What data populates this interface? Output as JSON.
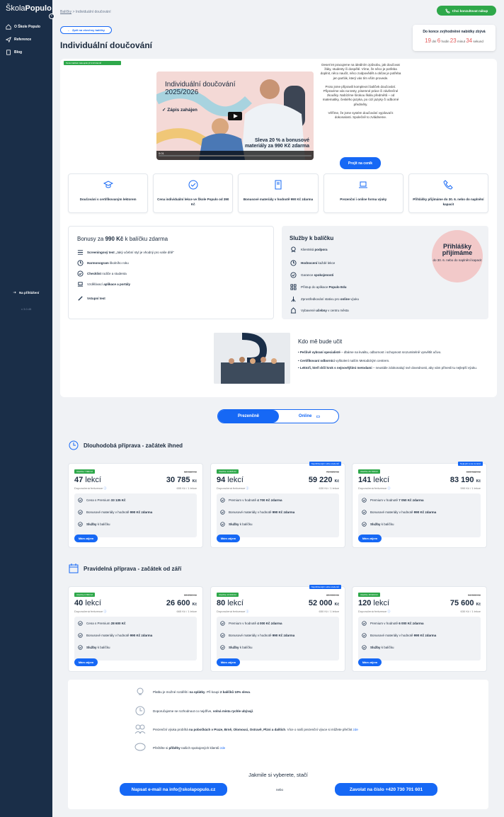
{
  "sidebar": {
    "logo_light": "Škola",
    "logo_bold": "Populo",
    "items": [
      {
        "label": "O Škole Populo",
        "icon": "home-icon"
      },
      {
        "label": "Reference",
        "icon": "paper-plane-icon"
      },
      {
        "label": "Blog",
        "icon": "document-icon"
      }
    ],
    "signin": "Na přihlášení",
    "version": "v 3.0.45"
  },
  "breadcrumb": {
    "parent": "Balíčky",
    "sep": ">",
    "current": "Individuální doučování"
  },
  "header": {
    "consult_button": "Chci konzultovat nákup",
    "back_button": "Zpět na všechny balíčky",
    "title": "Individuální doučování"
  },
  "countdown": {
    "title": "Do konce zvýhodněné nabídky zbývá",
    "days": "19",
    "days_label": "dní",
    "hours": "6",
    "hours_label": "hodin",
    "minutes": "23",
    "minutes_label": "minut",
    "seconds": "34",
    "seconds_label": "sekund"
  },
  "top_badge": "Tento balíček zakoupilo již 213 klientů",
  "video": {
    "title_1": "Individuální doučování",
    "title_2": "2025/2026",
    "open": "Zápis zahájen",
    "sale_1": "Sleva 20 % a bonusové",
    "sale_2": "materiály za 990 Kč zdarma",
    "time": "0:01"
  },
  "intro": {
    "p1": "Deset let pracujeme na ideálním způsobu, jak doučovat žáky, studenty či dospělé. Víme, že něco je potřeba doplnit, něco naučit, něco zodpovědět a občas je potřeba jen parťák, který vás tím vším provede.",
    "p2": "Proto jsme připravili komplexní balíček doučování. Připravíme vás na testy, písemné práce či závěrečné zkoušky. Nabízíme širokou škálu předmětů – od matematiky, českého jazyka, po cizí jazyky či odborné předměty.",
    "p3": "Věříme, že jsme systém doučování vypiloval k dokonalosti. Společně to zvládneme.",
    "button": "Projít na ceník"
  },
  "features": [
    {
      "label": "Doučování s certifikovaným lektorem",
      "icon": "graduation-cap-icon"
    },
    {
      "label": "Cena individuální lekce ve Škole Populo od 390 Kč",
      "icon": "check-circle-icon"
    },
    {
      "label": "Bonusové materiály v hodnotě 990 Kč zdarma",
      "icon": "book-icon"
    },
    {
      "label": "Prezenční i online forma výuky",
      "icon": "laptop-icon"
    },
    {
      "label": "Přihlášky přijímáme do 30. 6. nebo do naplnění kapacit",
      "icon": "phone-icon"
    }
  ],
  "bonus": {
    "title_a": "Bonusy za ",
    "title_b": "990 Kč",
    "title_c": " k balíčku zdarma",
    "items": [
      {
        "bold": "Screeningový test",
        "text": " „Jaký učební styl je vhodný pro vaše dítě\"",
        "icon": "checklist-icon"
      },
      {
        "bold": "Harmonogram",
        "text": " školního roku",
        "icon": "clock-icon"
      },
      {
        "bold": "Checklist",
        "text": " rodiče a studenta",
        "icon": "check-circle-icon"
      },
      {
        "bold": "",
        "text": "Vzdělávací ",
        "bold2": "aplikace a portály",
        "icon": "laptop-icon"
      },
      {
        "bold": "Vstupní test",
        "text": "",
        "icon": "pen-icon"
      }
    ]
  },
  "services": {
    "title": "Služby k balíčku",
    "items": [
      {
        "text": "Klientská ",
        "bold": "podpora",
        "icon": "support-icon"
      },
      {
        "bold": "Hodnocení",
        "text": " každé lekce",
        "icon": "clock-icon"
      },
      {
        "text": "Garance ",
        "bold": "spokojenosti",
        "icon": "check-circle-icon"
      },
      {
        "text": "Přístup do aplikace ",
        "bold": "Populo Edu",
        "icon": "grid-icon"
      },
      {
        "text": "Zprostředkování stativu pro ",
        "bold": "online",
        "text2": " výuku",
        "icon": "tripod-icon"
      },
      {
        "text": "Vybavené ",
        "bold": "učebny",
        "text2": " v centru města",
        "icon": "building-icon"
      }
    ],
    "bubble_title": "Přihlášky přijímáme",
    "bubble_text": "do 30. 6. nebo do naplnění kapacit"
  },
  "who": {
    "title": "Kdo mě bude učit",
    "items": [
      {
        "bold": "Pečlivě vybraní specialisté",
        "text": " – dbáme na kvalitu, odbornost i schopnost srozumitelně vysvětlit učivo."
      },
      {
        "bold": "Certifikovaní odborníci",
        "text": " vyškolení naším Metodickým centrem."
      },
      {
        "bold": "Lektoři, kteří drží krok s nejnovějšími metodami",
        "text": " – neustále zdokonalují své dovednosti, aby vám přinesli tu nejlepší výuku."
      }
    ]
  },
  "toggle": {
    "active": "Prezenčně",
    "inactive": "Online"
  },
  "sections": [
    {
      "title": "Dlouhodobá příprava - začátek ihned",
      "icon": "clock-arrow-icon",
      "cards": [
        {
          "badge": "Ušetříte 7 696 Kč",
          "rec": "",
          "old": "38 480 Kč",
          "lessons": "47",
          "lessons_word": "lekcí",
          "price": "30 785",
          "cur": "Kč",
          "freq": "Doporučená frekvence",
          "per": "655 Kč / 1 lekce",
          "items": [
            [
              "Cena s Premium ",
              "33 135 Kč",
              ""
            ],
            [
              "Bonusové materiály v hodnotě ",
              "990 Kč zdarma",
              ""
            ],
            [
              "",
              "Služby",
              " k balíčku"
            ]
          ],
          "button": "Mám zájem"
        },
        {
          "badge": "Ušetříte 14 805 Kč",
          "rec": "Nejoblíbenější volba studentů",
          "old": "74 025 Kč",
          "lessons": "94",
          "lessons_word": "lekcí",
          "price": "59 220",
          "cur": "Kč",
          "freq": "Doporučená frekvence",
          "per": "630 Kč / 1 lekce",
          "items": [
            [
              "Premium v hodnotě ",
              "4 700 Kč zdarma",
              ""
            ],
            [
              "Bonusové materiály v hodnotě ",
              "990 Kč zdarma",
              ""
            ],
            [
              "",
              "Služby",
              " k balíčku"
            ]
          ],
          "button": "Mám zájem"
        },
        {
          "badge": "Ušetříte 20 798 Kč",
          "rec": "Nejlepší cena za lekci",
          "old": "103 988 Kč",
          "lessons": "141",
          "lessons_word": "lekcí",
          "price": "83 190",
          "cur": "Kč",
          "freq": "Doporučená frekvence",
          "per": "590 Kč / 1 lekce",
          "items": [
            [
              "Premium v hodnotě ",
              "7 050 Kč zdarma",
              ""
            ],
            [
              "Bonusové materiály v hodnotě ",
              "990 Kč zdarma",
              ""
            ],
            [
              "",
              "Služby",
              " k balíčku"
            ]
          ],
          "button": "Mám zájem"
        }
      ]
    },
    {
      "title": "Pravidelná příprava - začátek od září",
      "icon": "calendar-icon",
      "cards": [
        {
          "badge": "Ušetříte 6 650 Kč",
          "rec": "",
          "old": "33 250 Kč",
          "lessons": "40",
          "lessons_word": "lekcí",
          "price": "26 600",
          "cur": "Kč",
          "freq": "Doporučená frekvence",
          "per": "665 Kč / 1 lekce",
          "items": [
            [
              "Cena s Premium ",
              "28 600 Kč",
              ""
            ],
            [
              "Bonusové materiály v hodnotě ",
              "990 Kč zdarma",
              ""
            ],
            [
              "",
              "Služby",
              " k balíčku"
            ]
          ],
          "button": "Mám zájem"
        },
        {
          "badge": "Ušetříte 13 000 Kč",
          "rec": "Nejoblíbenější volba studentů",
          "old": "65 000 Kč",
          "lessons": "80",
          "lessons_word": "lekcí",
          "price": "52 000",
          "cur": "Kč",
          "freq": "Doporučená frekvence",
          "per": "650 Kč / 1 lekce",
          "items": [
            [
              "Premium v hodnotě ",
              "4 000 Kč zdarma",
              ""
            ],
            [
              "Bonusové materiály v hodnotě ",
              "990 Kč zdarma",
              ""
            ],
            [
              "",
              "Služby",
              " k balíčku"
            ]
          ],
          "button": "Mám zájem"
        },
        {
          "badge": "Ušetříte 18 900 Kč",
          "rec": "",
          "old": "94 500 Kč",
          "lessons": "120",
          "lessons_word": "lekcí",
          "price": "75 600",
          "cur": "Kč",
          "freq": "Doporučená frekvence",
          "per": "630 Kč / 1 lekce",
          "items": [
            [
              "Premium v hodnotě ",
              "6 000 Kč zdarma",
              ""
            ],
            [
              "Bonusové materiály v hodnotě ",
              "990 Kč zdarma",
              ""
            ],
            [
              "",
              "Služby",
              " k balíčku"
            ]
          ],
          "button": "Mám zájem"
        }
      ]
    }
  ],
  "info": {
    "rows": [
      {
        "a": "Platbu je možné rozdělit i ",
        "b": "na splátky",
        "c": ". Při koupi ",
        "d": "2 balíčků 10% sleva",
        "e": ".",
        "icon": "lightbulb-icon"
      },
      {
        "a": "Doporučujeme se rozhodnout co nejdříve, ",
        "b": "volná místa rychle ubývají",
        "c": ".",
        "icon": "clock-icon"
      },
      {
        "a": "Prezenční výuka probíhá ",
        "b": "na pobočkách v Praze, Brně, Olomouci, Ostravě, Plzni a dalších",
        "c": ". Více o naší prezenční výuce si můžete přečíst ",
        "link": "zde",
        "icon": "people-icon"
      },
      {
        "a": "Přečtěte si ",
        "b": "příběhy",
        "c": " našich spokojených klientů ",
        "link": "zde",
        "icon": "chat-icon"
      }
    ],
    "pick": "Jakmile si vyberete, stačí",
    "email_button": "Napsat e-mail na info@skolapopulo.cz",
    "or": "nebo",
    "phone_button": "Zavolat na číslo +420 730 701 601"
  }
}
